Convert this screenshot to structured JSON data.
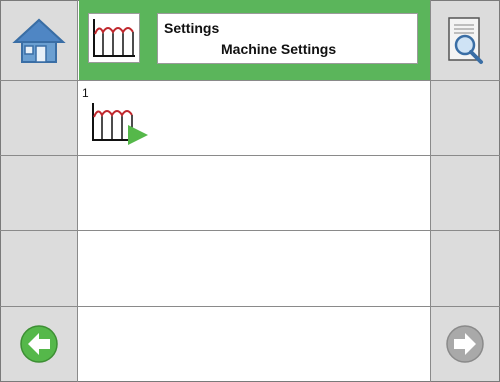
{
  "header": {
    "title": "Settings",
    "subtitle": "Machine Settings"
  },
  "list": {
    "items": [
      {
        "number": "1"
      }
    ]
  },
  "icons": {
    "home": "home-icon",
    "header": "trend-chart-icon",
    "report": "document-search-icon",
    "row": "trend-chart-play-icon",
    "back": "arrow-left-icon",
    "forward": "arrow-right-icon"
  },
  "colors": {
    "header_bg": "#5bb55b",
    "back_button": "#55b84a",
    "forward_button": "#a9a9a9"
  }
}
